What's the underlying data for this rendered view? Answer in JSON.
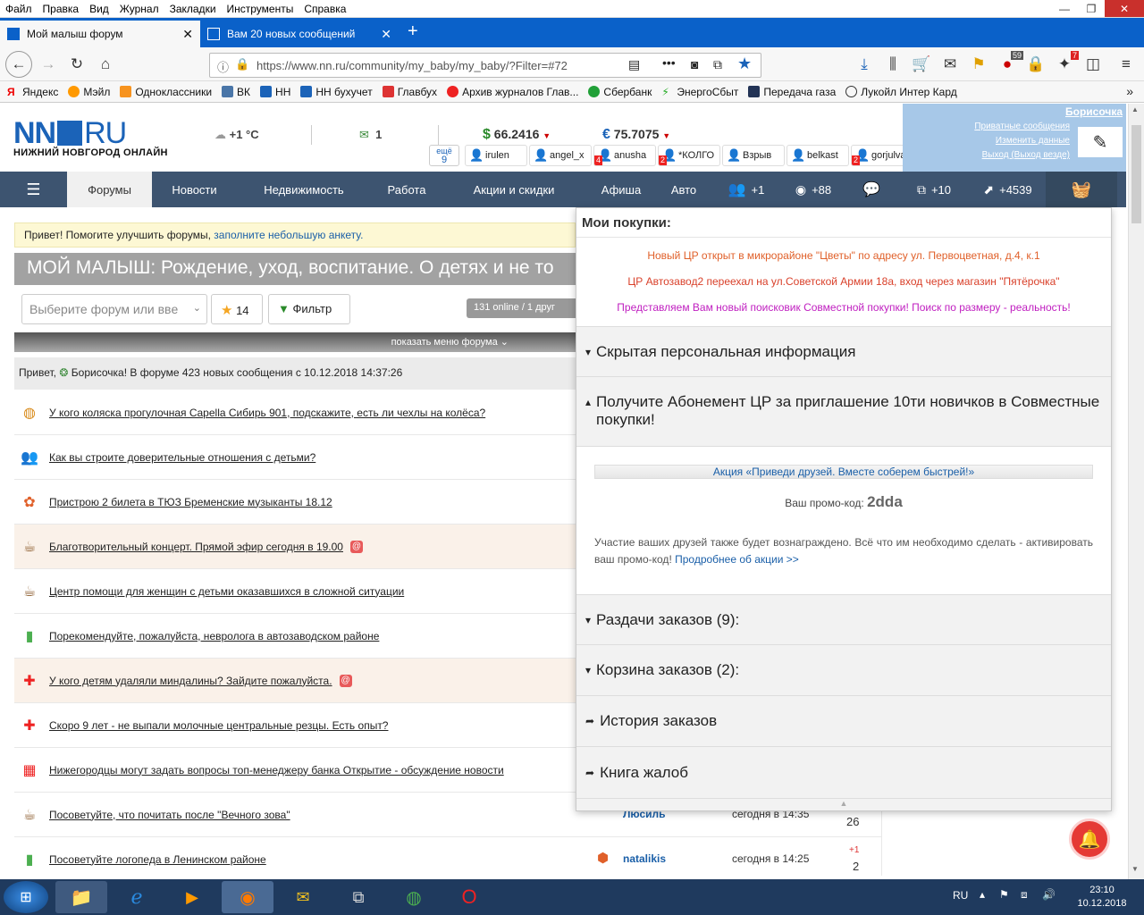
{
  "browser": {
    "menu": [
      "Файл",
      "Правка",
      "Вид",
      "Журнал",
      "Закладки",
      "Инструменты",
      "Справка"
    ],
    "tabs": [
      {
        "title": "Мой малыш форум"
      },
      {
        "title": "Вам 20 новых сообщений"
      }
    ],
    "url": "https://www.nn.ru/community/my_baby/my_baby/?Filter=#72",
    "badges": {
      "adblock": "59",
      "notif": "7"
    },
    "bookmarks": [
      "Яндекс",
      "Мэйл",
      "Одноклассники",
      "ВК",
      "НН",
      "НН бухучет",
      "Главбух",
      "Архив журналов Глав...",
      "Сбербанк",
      "ЭнергоСбыт",
      "Передача газа",
      "Лукойл Интер Кард"
    ]
  },
  "header": {
    "logo_left": "NN",
    "logo_right": "RU",
    "logo_sub": "НИЖНИЙ НОВГОРОД ОНЛАЙН",
    "temp": "+1 °C",
    "mail_count": "1",
    "usd": "66.2416",
    "eur": "75.7075",
    "more_label": "ещё",
    "more_count": "9",
    "users": [
      {
        "name": "irulen",
        "badge": ""
      },
      {
        "name": "angel_x",
        "badge": ""
      },
      {
        "name": "anusha",
        "badge": "4"
      },
      {
        "name": "*КОЛГО",
        "badge": "2"
      },
      {
        "name": "Взрыв",
        "badge": ""
      },
      {
        "name": "belkast",
        "badge": ""
      },
      {
        "name": "gorjulva",
        "badge": "2"
      }
    ],
    "user_menu": {
      "name": "Борисочка",
      "links": [
        "Приватные сообщения",
        "Изменить данные",
        "Выход (Выход везде)"
      ]
    }
  },
  "nav": {
    "items": [
      "Форумы",
      "Новости",
      "Недвижимость",
      "Работа",
      "Акции и скидки",
      "Афиша",
      "Авто"
    ],
    "stats": {
      "friends": "+1",
      "views": "+88",
      "pages": "+10",
      "rating": "+4539"
    }
  },
  "forum": {
    "survey_text": "Привет! Помогите улучшить форумы,",
    "survey_link": "заполните небольшую анкету.",
    "title": "МОЙ МАЛЫШ: Рождение, уход, воспитание. О детях и не то",
    "select_placeholder": "Выберите форум или ввe",
    "fav_count": "14",
    "filter_label": "Фильтр",
    "online": "131 online / 1 друг",
    "show_menu": "показать меню форума",
    "greeting_pre": "Привет,",
    "greeting_post": "Борисочка! В форуме 423 новых сообщения с 10.12.2018 14:37:26",
    "topics": [
      {
        "title": "У кого коляска прогулочная Capella Сибирь 901, подскажите, есть ли чехлы на колёса?",
        "icon": "globe-icon",
        "at": false
      },
      {
        "title": "Как вы строите доверительные отношения с детьми?",
        "icon": "people-icon",
        "at": false
      },
      {
        "title": "Пристрою 2 билета в ТЮЗ Бременские музыканты 18.12",
        "icon": "flower-icon",
        "at": false
      },
      {
        "title": "Благотворительный концерт. Прямой эфир сегодня в 19.00",
        "icon": "cup-icon",
        "at": true
      },
      {
        "title": "Центр помощи для женщин с детьми оказавшихся в сложной ситуации",
        "icon": "cup-icon",
        "at": false
      },
      {
        "title": "Порекомендуйте, пожалуйста, невролога в автозаводском районе",
        "icon": "chart-icon",
        "at": false
      },
      {
        "title": "У кого детям удаляли миндалины? Зайдите пожалуйста.",
        "icon": "cross-icon",
        "at": true
      },
      {
        "title": "Скоро 9 лет - не выпали молочные центральные резцы. Есть опыт?",
        "icon": "cross-icon",
        "at": false
      },
      {
        "title": "Нижегородцы могут задать вопросы топ-менеджеру банка Открытие - обсуждение новости",
        "icon": "grid-icon",
        "at": false
      },
      {
        "title": "Посоветуйте, что почитать после \"Вечного зова\"",
        "icon": "cup-icon",
        "at": false
      },
      {
        "title": "Посоветуйте логопеда в Ленинском районе",
        "icon": "chart-icon",
        "at": false
      }
    ],
    "peek_rows": [
      {
        "author": "Люсиль",
        "time": "сегодня в 14:35",
        "plus": "",
        "count": "26"
      },
      {
        "author": "natalikis",
        "time": "сегодня в 14:25",
        "plus": "+1",
        "count": "2"
      }
    ]
  },
  "popup": {
    "title": "Мои покупки:",
    "news": [
      {
        "text": "Новый ЦР открыт в микрорайоне \"Цветы\" по адресу ул. Первоцветная, д.4, к.1",
        "color": "#e0602a"
      },
      {
        "text": "ЦР Автозавод2 переехал на ул.Советской Армии 18а, вход через магазин \"Пятёрочка\"",
        "color": "#d9402a"
      },
      {
        "text": "Представляем Вам новый поисковик Совместной покупки! Поиск по размеру - реальность!",
        "color": "#c020c0"
      }
    ],
    "hidden_info": "Скрытая персональная информация",
    "subscription_title": "Получите Абонемент ЦР за приглашение 10ти новичков в Совместные покупки!",
    "promo_banner": "Акция «Приведи друзей. Вместе соберем быстрей!»",
    "promo_label": "Ваш промо-код:",
    "promo_code": "2dda",
    "promo_text": "Участие ваших друзей также будет вознаграждено. Всё что им необходимо сделать - активировать ваш промо-код!",
    "promo_link": "Продробнее об акции >>",
    "sections": [
      "Раздачи заказов (9):",
      "Корзина заказов (2):",
      "История заказов",
      "Книга жалоб"
    ]
  },
  "taskbar": {
    "lang": "RU",
    "time": "23:10",
    "date": "10.12.2018"
  },
  "colors": {
    "accent": "#1b63b8",
    "nav": "#3d5470",
    "tabbar": "#0a61c9",
    "link": "#1a5fa8"
  }
}
